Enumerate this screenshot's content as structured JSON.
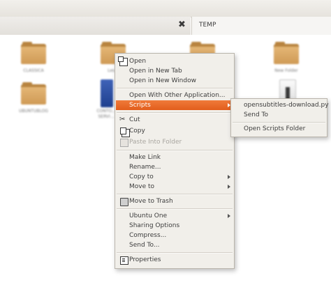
{
  "window": {
    "tab_active_title": "TEMP"
  },
  "files": [
    {
      "label": "CLASSICA",
      "icon": "folder-icon"
    },
    {
      "label": "Les...",
      "icon": "folder-icon"
    },
    {
      "label": "",
      "icon": "folder-icon"
    },
    {
      "label": "New Folder",
      "icon": "folder-icon"
    },
    {
      "label": "UBUNTUBLOG",
      "icon": "folder-icon"
    },
    {
      "label": "CONTO...",
      "icon": "document-blue-icon"
    },
    {
      "label": "SERVI...",
      "icon": "document-blue-icon"
    },
    {
      "label": "",
      "icon": "document-white-icon"
    }
  ],
  "context_menu": {
    "open": "Open",
    "open_new_tab": "Open in New Tab",
    "open_new_window": "Open in New Window",
    "open_other_app": "Open With Other Application...",
    "scripts": "Scripts",
    "cut": "Cut",
    "copy": "Copy",
    "paste_into_folder": "Paste Into Folder",
    "make_link": "Make Link",
    "rename": "Rename...",
    "copy_to": "Copy to",
    "move_to": "Move to",
    "move_to_trash": "Move to Trash",
    "ubuntu_one": "Ubuntu One",
    "sharing_options": "Sharing Options",
    "compress": "Compress...",
    "send_to": "Send To...",
    "properties": "Properties"
  },
  "scripts_submenu": {
    "script1": "opensubtitles-download.py",
    "send_to": "Send To",
    "open_scripts_folder": "Open Scripts Folder"
  },
  "colors": {
    "highlight": "#e8692a",
    "menu_bg": "#f1efea",
    "folder": "#d6a462"
  }
}
